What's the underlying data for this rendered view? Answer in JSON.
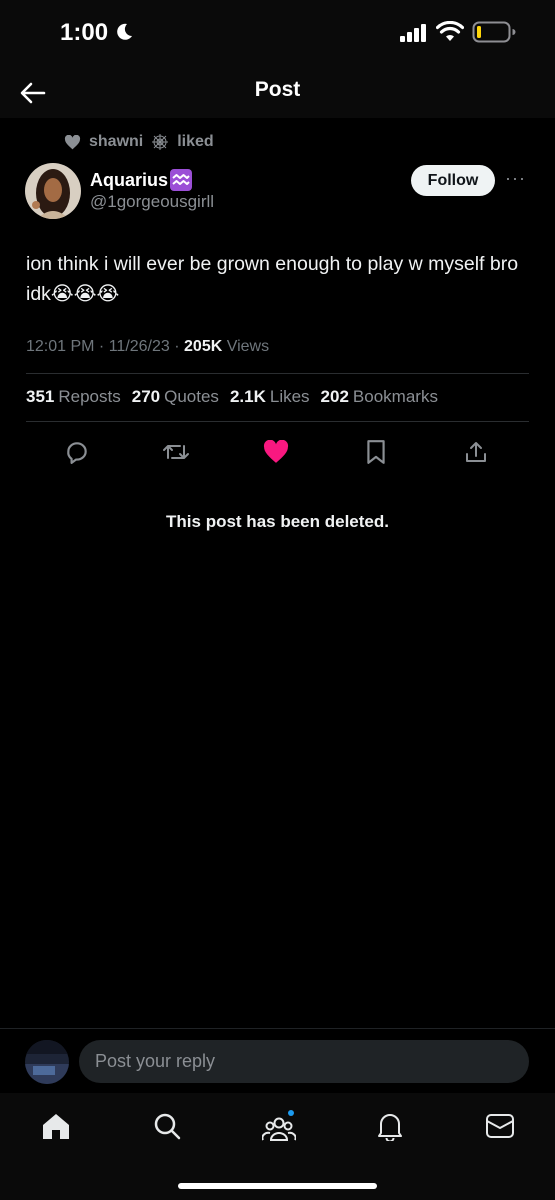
{
  "status_bar": {
    "time": "1:00",
    "icons": [
      "moon-icon",
      "signal-icon",
      "wifi-icon",
      "battery-icon"
    ]
  },
  "header": {
    "title": "Post",
    "back_icon": "arrow-left-icon"
  },
  "social_context": {
    "icon": "heart-icon",
    "user": "shawni",
    "emoji_icon": "spider-web-icon",
    "action": "liked"
  },
  "author": {
    "name": "Aquarius",
    "zodiac_icon": "aquarius-icon",
    "handle": "@1gorgeousgirll",
    "follow_label": "Follow",
    "more_label": "···"
  },
  "post": {
    "text": "ion think i will ever be grown enough to play w myself bro idk😭😭😭",
    "time": "12:01 PM · 11/26/23 · ",
    "views_count": "205K",
    "views_label": " Views"
  },
  "stats": [
    {
      "count": "351",
      "label": "Reposts"
    },
    {
      "count": "270",
      "label": "Quotes"
    },
    {
      "count": "2.1K",
      "label": "Likes"
    },
    {
      "count": "202",
      "label": "Bookmarks"
    }
  ],
  "actions": {
    "icons": [
      "reply-icon",
      "repost-icon",
      "like-icon",
      "bookmark-icon",
      "share-icon"
    ],
    "like_color": "#f91880"
  },
  "deleted_note": "This post has been deleted.",
  "reply": {
    "placeholder": "Post your reply"
  },
  "tabs": [
    "home-icon",
    "search-icon",
    "communities-icon",
    "notifications-icon",
    "messages-icon"
  ],
  "colors": {
    "background": "#000000",
    "muted": "#8b8f94",
    "like": "#f91880",
    "badge": "#1d9bf0"
  }
}
